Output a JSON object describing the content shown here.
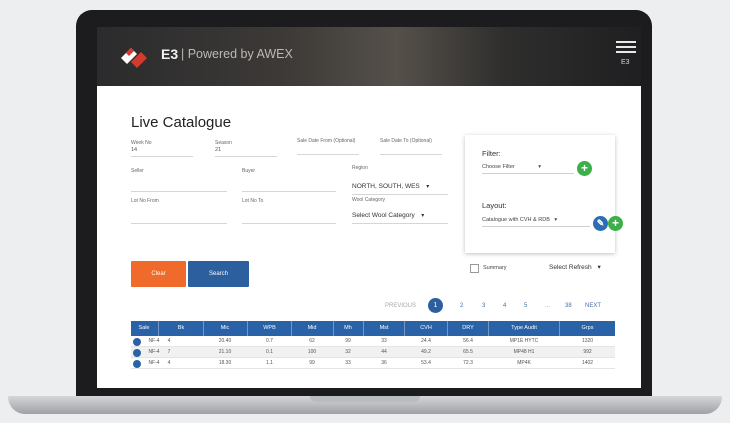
{
  "header": {
    "app_name": "E3",
    "powered_by": "| Powered by AWEX",
    "extra": "E3"
  },
  "page_title": "Live Catalogue",
  "form": {
    "week_no": {
      "label": "Week No",
      "value": "14"
    },
    "season": {
      "label": "Season",
      "value": "21"
    },
    "sale_date_from": {
      "label": "Sale Date From (Optional)",
      "value": ""
    },
    "sale_date_to": {
      "label": "Sale Date To (Optional)",
      "value": ""
    },
    "seller": {
      "label": "Seller",
      "value": ""
    },
    "buyer": {
      "label": "Buyer",
      "value": ""
    },
    "region": {
      "label": "Region",
      "value": "NORTH, SOUTH, WES"
    },
    "lot_no_from": {
      "label": "Lot No From",
      "value": ""
    },
    "lot_no_to": {
      "label": "Lot No To",
      "value": ""
    },
    "wool_category": {
      "label": "Wool Category",
      "value": "Select Wool Category"
    }
  },
  "filter_panel": {
    "filter_heading": "Filter:",
    "filter_select": "Choose Filter",
    "layout_heading": "Layout:",
    "layout_select": "Catalogue with CVH & RDB"
  },
  "buttons": {
    "clear": "Clear",
    "search": "Search"
  },
  "summary_label": "Summary",
  "select_refresh": "Select Refresh",
  "pagination": {
    "previous": "PREVIOUS",
    "pages": [
      "1",
      "2",
      "3",
      "4",
      "5",
      "...",
      "38"
    ],
    "active": "1",
    "next": "NEXT"
  },
  "table": {
    "columns": [
      "Sale",
      "Bk",
      "Mic",
      "WPB",
      "Mid",
      "Mh",
      "Mst",
      "CVH",
      "DRY",
      "Type Audit",
      "Grps"
    ],
    "rows": [
      [
        "NF-4",
        "4",
        "20.40",
        "0.7",
        "62",
        "99",
        "33",
        "24.4",
        "56.4",
        "MP1E HYTC",
        "1320"
      ],
      [
        "NF-4",
        "7",
        "21.10",
        "0.1",
        "100",
        "32",
        "44",
        "49.2",
        "65.5",
        "MP48 H1",
        "992"
      ],
      [
        "NF-4",
        "4",
        "18.30",
        "1.1",
        "99",
        "33",
        "36",
        "53.4",
        "72.3",
        "MP4K",
        "1402"
      ]
    ]
  },
  "colors": {
    "clear_button": "#f06a2b",
    "search_button": "#2c5f9e",
    "table_header": "#2a62a7",
    "add_button": "#3cae4a",
    "edit_button": "#2c6db3"
  },
  "icons": {
    "logo": "awex-logo-icon",
    "menu": "hamburger-menu-icon",
    "add": "plus-icon",
    "edit": "pencil-icon"
  }
}
